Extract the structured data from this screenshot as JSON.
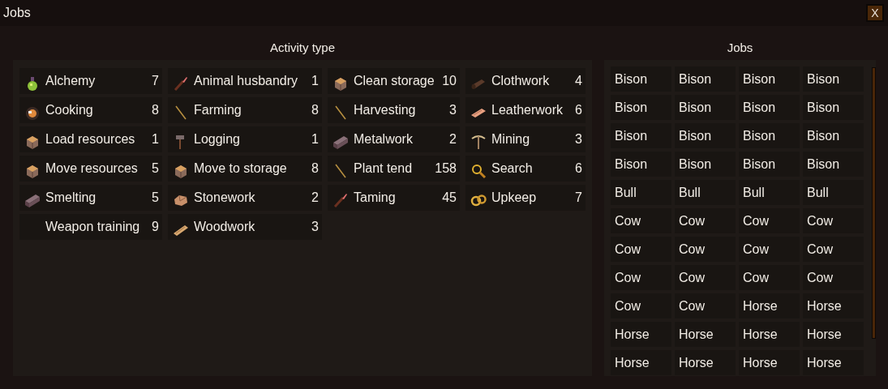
{
  "window": {
    "title": "Jobs",
    "close_label": "X"
  },
  "activity_panel": {
    "heading": "Activity type",
    "activities": [
      {
        "name": "Alchemy",
        "count": "7"
      },
      {
        "name": "Animal husbandry",
        "count": "1"
      },
      {
        "name": "Clean storage",
        "count": "10"
      },
      {
        "name": "Clothwork",
        "count": "4"
      },
      {
        "name": "Cooking",
        "count": "8"
      },
      {
        "name": "Farming",
        "count": "8"
      },
      {
        "name": "Harvesting",
        "count": "3"
      },
      {
        "name": "Leatherwork",
        "count": "6"
      },
      {
        "name": "Load resources",
        "count": "1"
      },
      {
        "name": "Logging",
        "count": "1"
      },
      {
        "name": "Metalwork",
        "count": "2"
      },
      {
        "name": "Mining",
        "count": "3"
      },
      {
        "name": "Move resources",
        "count": "5"
      },
      {
        "name": "Move to storage",
        "count": "8"
      },
      {
        "name": "Plant tend",
        "count": "158"
      },
      {
        "name": "Search",
        "count": "6"
      },
      {
        "name": "Smelting",
        "count": "5"
      },
      {
        "name": "Stonework",
        "count": "2"
      },
      {
        "name": "Taming",
        "count": "45"
      },
      {
        "name": "Upkeep",
        "count": "7"
      },
      {
        "name": "Weapon training",
        "count": "9"
      },
      {
        "name": "Woodwork",
        "count": "3"
      }
    ]
  },
  "jobs_panel": {
    "heading": "Jobs",
    "jobs": [
      "Bison",
      "Bison",
      "Bison",
      "Bison",
      "Bison",
      "Bison",
      "Bison",
      "Bison",
      "Bison",
      "Bison",
      "Bison",
      "Bison",
      "Bison",
      "Bison",
      "Bison",
      "Bison",
      "Bull",
      "Bull",
      "Bull",
      "Bull",
      "Cow",
      "Cow",
      "Cow",
      "Cow",
      "Cow",
      "Cow",
      "Cow",
      "Cow",
      "Cow",
      "Cow",
      "Cow",
      "Cow",
      "Cow",
      "Cow",
      "Horse",
      "Horse",
      "Horse",
      "Horse",
      "Horse",
      "Horse",
      "Horse",
      "Horse",
      "Horse",
      "Horse"
    ]
  }
}
